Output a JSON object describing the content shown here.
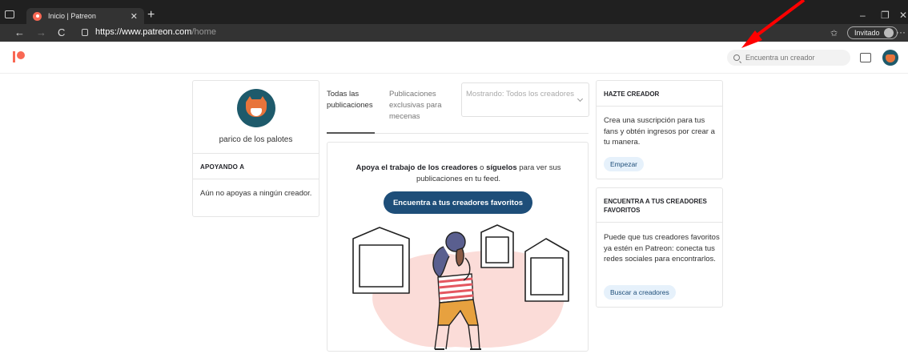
{
  "browser": {
    "tab_title": "Inicio | Patreon",
    "tab_close": "✕",
    "new_tab": "+",
    "url_main": "https://www.patreon.com",
    "url_path": "/home",
    "profile_label": "Invitado",
    "more": "···",
    "minimize": "–",
    "restore": "❐",
    "close": "✕",
    "back": "←",
    "forward": "→",
    "reload": "C"
  },
  "header": {
    "search_placeholder": "Encuentra un creador",
    "brand_color": "#f96854"
  },
  "profile": {
    "name": "parico de los palotes",
    "supporting_title": "APOYANDO A",
    "supporting_text": "Aún no apoyas a ningún creador."
  },
  "feed": {
    "tabs": [
      {
        "label": "Todas las publicaciones",
        "active": true
      },
      {
        "label": "Publicaciones exclusivas para mecenas",
        "active": false
      }
    ],
    "filter": "Mostrando: Todos los creadores",
    "empty_bold_1": "Apoya el trabajo de los creadores",
    "empty_mid": " o ",
    "empty_bold_2": "síguelos",
    "empty_rest": " para ver sus publicaciones en tu feed.",
    "cta": "Encuentra a tus creadores favoritos",
    "cta_color": "#1e4e79"
  },
  "sidebar": {
    "become_title": "HAZTE CREADOR",
    "become_text": "Crea una suscripción para tus fans y obtén ingresos por crear a tu manera.",
    "become_button": "Empezar",
    "find_title": "ENCUENTRA A TUS CREADORES FAVORITOS",
    "find_text": "Puede que tus creadores favoritos ya estén en Patreon: conecta tus redes sociales para encontrarlos.",
    "find_button": "Buscar a creadores"
  },
  "annotation": {
    "arrow_color": "#ff0000"
  }
}
